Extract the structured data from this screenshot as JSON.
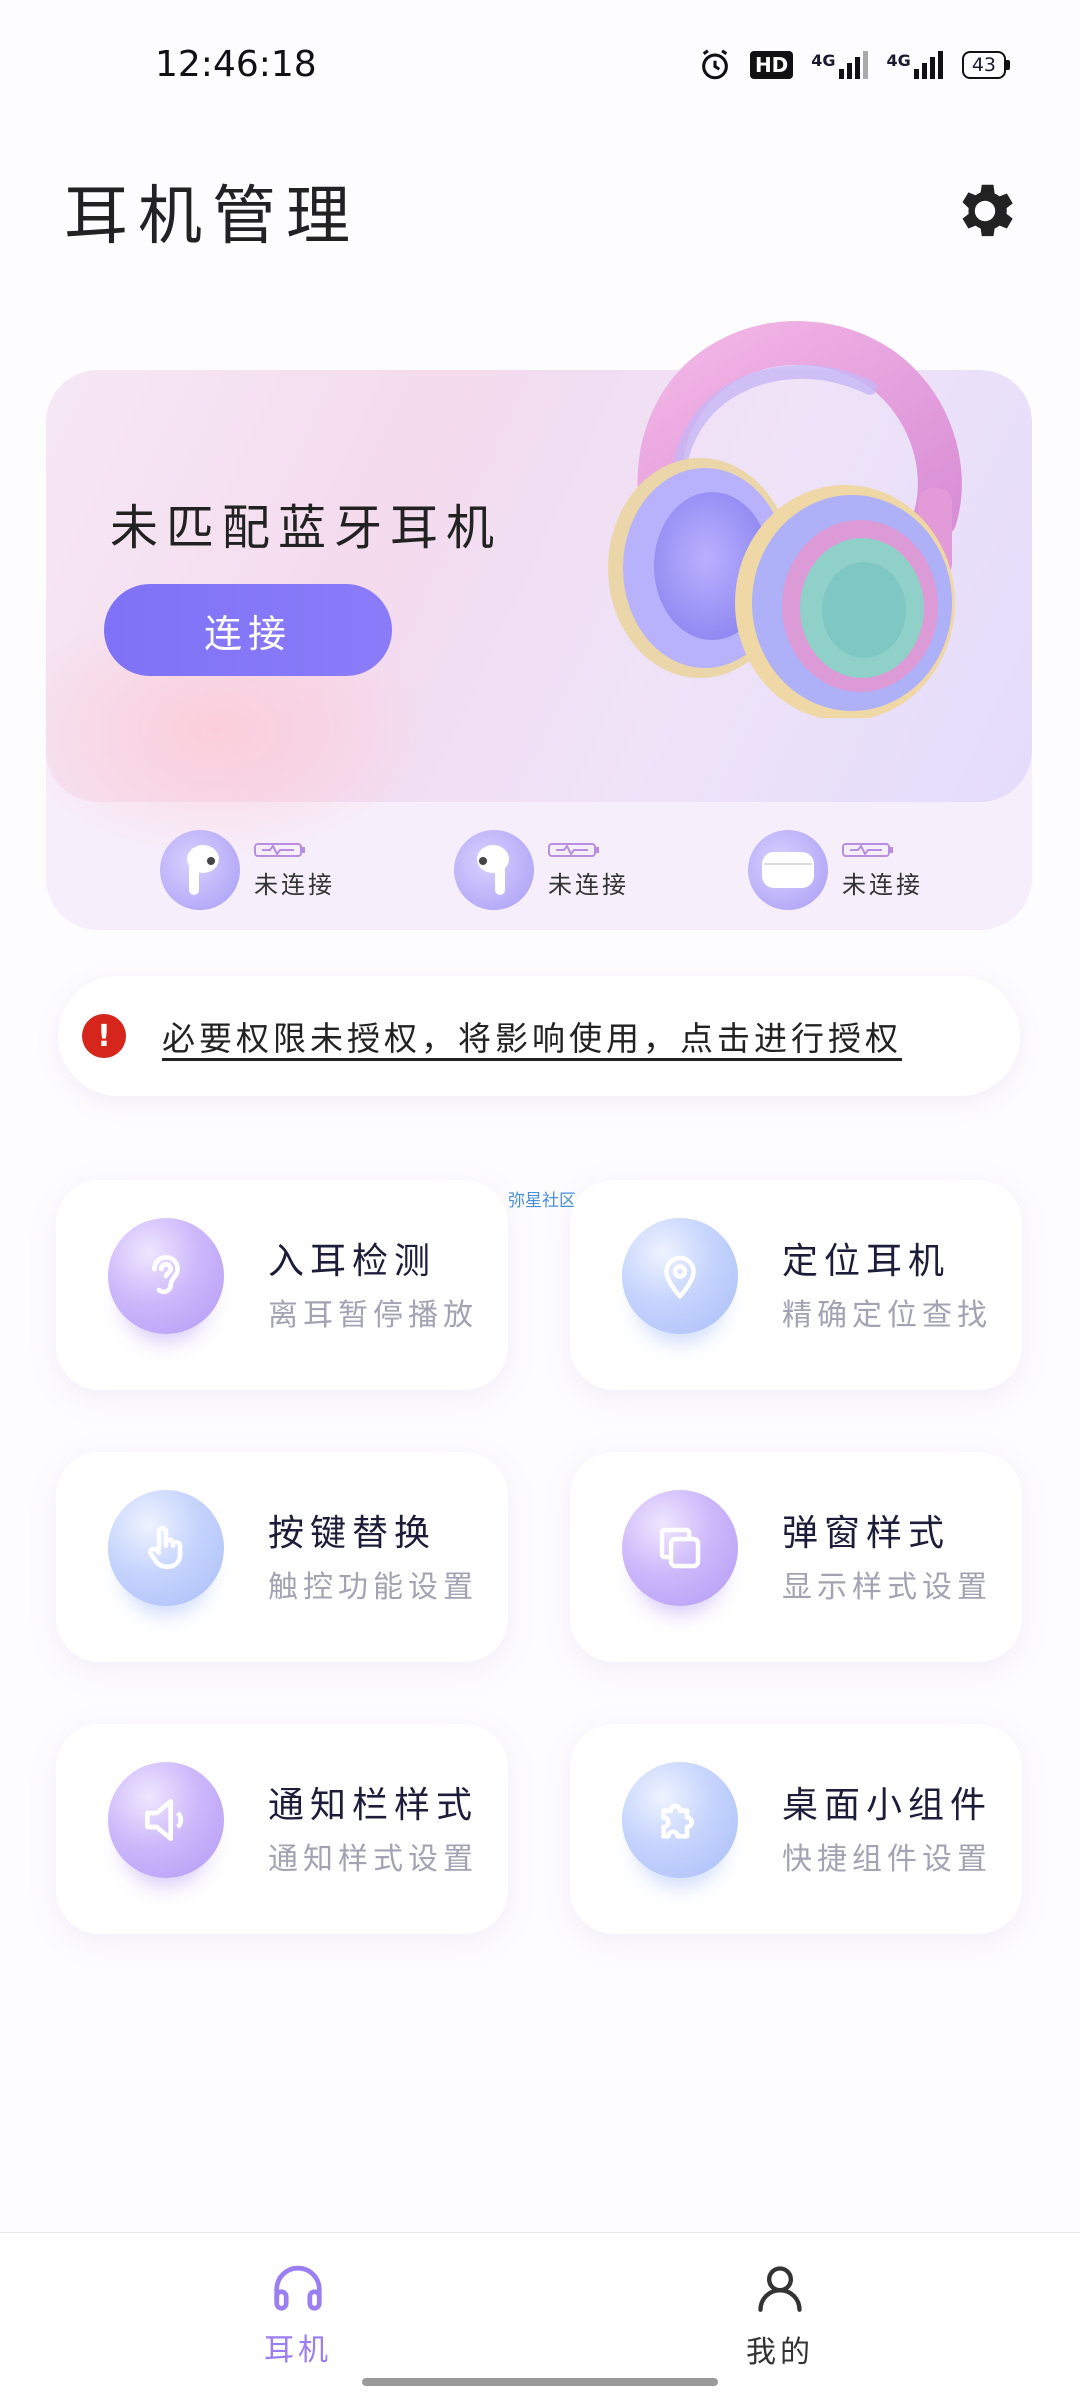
{
  "status_bar": {
    "time": "12:46:18",
    "hd": "HD",
    "net1": "4G",
    "net2": "4G",
    "battery": "43"
  },
  "header": {
    "title": "耳机管理"
  },
  "hero": {
    "title": "未匹配蓝牙耳机",
    "connect_label": "连接"
  },
  "devices": [
    {
      "status": "未连接"
    },
    {
      "status": "未连接"
    },
    {
      "status": "未连接"
    }
  ],
  "permission": {
    "text": "必要权限未授权，将影响使用，点击进行授权"
  },
  "watermark": "弥星社区",
  "features": [
    {
      "title": "入耳检测",
      "subtitle": "离耳暂停播放"
    },
    {
      "title": "定位耳机",
      "subtitle": "精确定位查找"
    },
    {
      "title": "按键替换",
      "subtitle": "触控功能设置"
    },
    {
      "title": "弹窗样式",
      "subtitle": "显示样式设置"
    },
    {
      "title": "通知栏样式",
      "subtitle": "通知样式设置"
    },
    {
      "title": "桌面小组件",
      "subtitle": "快捷组件设置"
    }
  ],
  "nav": {
    "items": [
      {
        "label": "耳机"
      },
      {
        "label": "我的"
      }
    ]
  },
  "colors": {
    "accent": "#8b7cf6",
    "alert": "#d6251b"
  }
}
